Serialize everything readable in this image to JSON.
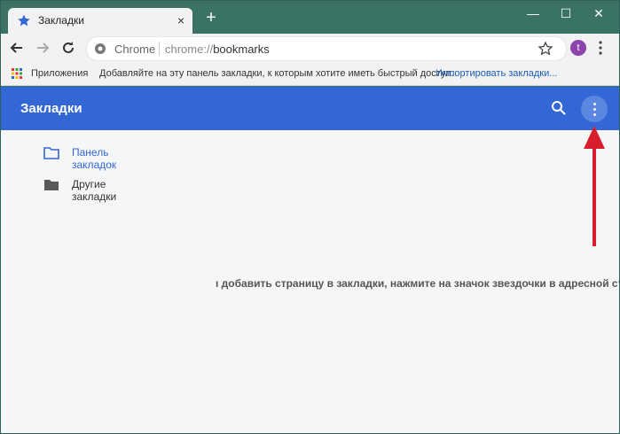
{
  "browser": {
    "tab": {
      "title": "Закладки",
      "close_glyph": "×"
    },
    "new_tab_glyph": "+",
    "window_controls": {
      "minimize": "—",
      "maximize": "☐",
      "close": "✕"
    }
  },
  "toolbar": {
    "omnibox": {
      "site_label": "Chrome",
      "url_scheme": "chrome://",
      "url_path": "bookmarks"
    },
    "avatar_letter": "t"
  },
  "bookmarks_bar": {
    "apps_label": "Приложения",
    "hint": "Добавляйте на эту панель закладки, к которым хотите иметь быстрый доступ.",
    "import_link": "Импортировать закладки..."
  },
  "app": {
    "title": "Закладки",
    "accent_color": "#3367d6",
    "folders": [
      {
        "label": "Панель закладок",
        "selected": true,
        "icon": "folder-outline-icon"
      },
      {
        "label": "Другие закладки",
        "selected": false,
        "icon": "folder-filled-icon"
      }
    ],
    "empty_message": "ı добавить страницу в закладки, нажмите на значок звездочки в адресной стр"
  },
  "annotation": {
    "arrow_color": "#d81e2c"
  }
}
